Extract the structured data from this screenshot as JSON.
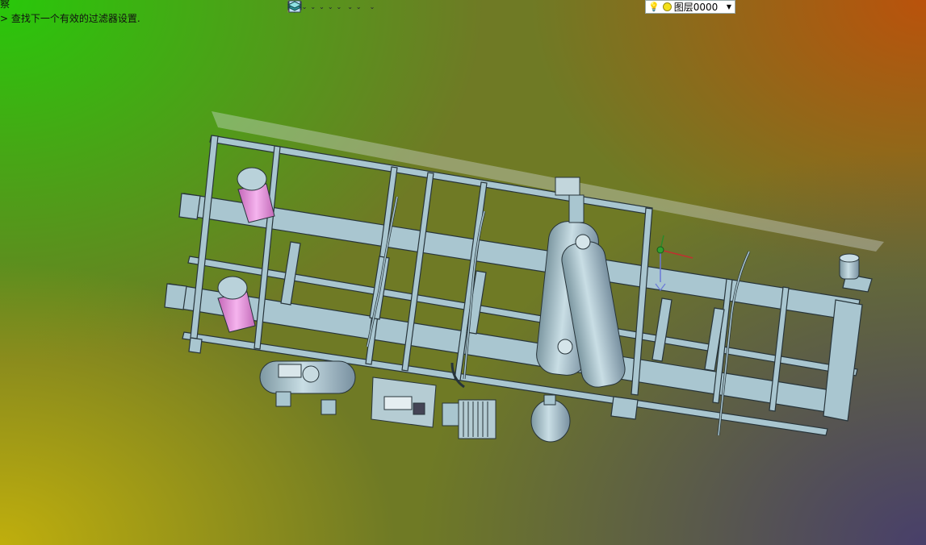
{
  "messages": {
    "line1": "察",
    "line2": "> 查找下一个有效的过滤器设置."
  },
  "toolbar": {
    "items": [
      {
        "icon": "exit-sketch-icon"
      },
      {
        "icon": "view-orientation-icon",
        "dropdown": true
      },
      {
        "icon": "edit-pen-icon"
      },
      {
        "icon": "section-view-icon",
        "dropdown": true
      },
      {
        "icon": "cube-shaded-icon",
        "dropdown": true
      },
      {
        "icon": "cube-wire-icon",
        "dropdown": true
      },
      {
        "icon": "appearance-icon",
        "dropdown": true
      },
      {
        "icon": "zoom-fit-icon",
        "dropdown": true
      },
      {
        "icon": "view-settings-icon"
      },
      {
        "icon": "hide-show-icon",
        "dropdown": true
      },
      {
        "icon": "monitor-icon",
        "dropdown": true
      },
      {
        "icon": "line-weight-icon"
      },
      {
        "icon": "color-swatch-icon"
      },
      {
        "icon": "layer-properties-icon",
        "dropdown": true
      }
    ]
  },
  "layer": {
    "current": "图层0000"
  },
  "colors": {
    "frame": "#a9c6d0",
    "frame_edge": "#27343a",
    "accent_pink": "#e58bd9"
  }
}
